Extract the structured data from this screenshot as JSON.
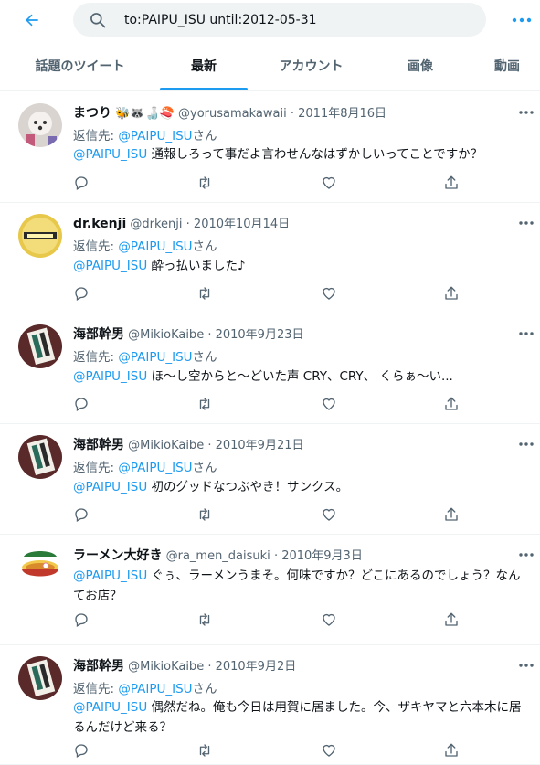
{
  "search": {
    "value": "to:PAIPU_ISU until:2012-05-31"
  },
  "tabs": [
    {
      "label": "話題のツイート",
      "active": false
    },
    {
      "label": "最新",
      "active": true
    },
    {
      "label": "アカウント",
      "active": false
    },
    {
      "label": "画像",
      "active": false
    },
    {
      "label": "動画",
      "active": false
    }
  ],
  "reply_prefix": "返信先: ",
  "reply_suffix": "さん",
  "tweets": [
    {
      "name": "まつり",
      "emoji": "🐝🦝🍶🍣",
      "handle": "@yorusamakawaii",
      "date": "· 2011年8月16日",
      "reply_to": "@PAIPU_ISU",
      "mention": "@PAIPU_ISU",
      "text": " 通報しろって事だよ言わせんなはずかしいってことですか？"
    },
    {
      "name": "dr.kenji",
      "emoji": "",
      "handle": "@drkenji",
      "date": "· 2010年10月14日",
      "reply_to": "@PAIPU_ISU",
      "mention": "@PAIPU_ISU",
      "text": " 酔っ払いました♪"
    },
    {
      "name": "海部幹男",
      "emoji": "",
      "handle": "@MikioKaibe",
      "date": "· 2010年9月23日",
      "reply_to": "@PAIPU_ISU",
      "mention": "@PAIPU_ISU",
      "text": " ほ～し空からと～どいた声 CRY、CRY、 くらぁ～い..."
    },
    {
      "name": "海部幹男",
      "emoji": "",
      "handle": "@MikioKaibe",
      "date": "· 2010年9月21日",
      "reply_to": "@PAIPU_ISU",
      "mention": "@PAIPU_ISU",
      "text": " 初のグッドなつぶやき！サンクス。"
    },
    {
      "name": "ラーメン大好き",
      "emoji": "",
      "handle": "@ra_men_daisuki",
      "date": "· 2010年9月3日",
      "reply_to": "",
      "mention": "@PAIPU_ISU",
      "text": " ぐぅ、ラーメンうまそ。何味ですか？どこにあるのでしょう？なんてお店？"
    },
    {
      "name": "海部幹男",
      "emoji": "",
      "handle": "@MikioKaibe",
      "date": "· 2010年9月2日",
      "reply_to": "@PAIPU_ISU",
      "mention": "@PAIPU_ISU",
      "text": " 偶然だね。俺も今日は用賀に居ました。今、ザキヤマと六本木に居るんだけど来る？"
    }
  ],
  "colors": {
    "accent": "#1d9bf0",
    "text": "#0f1419",
    "muted": "#536471"
  }
}
